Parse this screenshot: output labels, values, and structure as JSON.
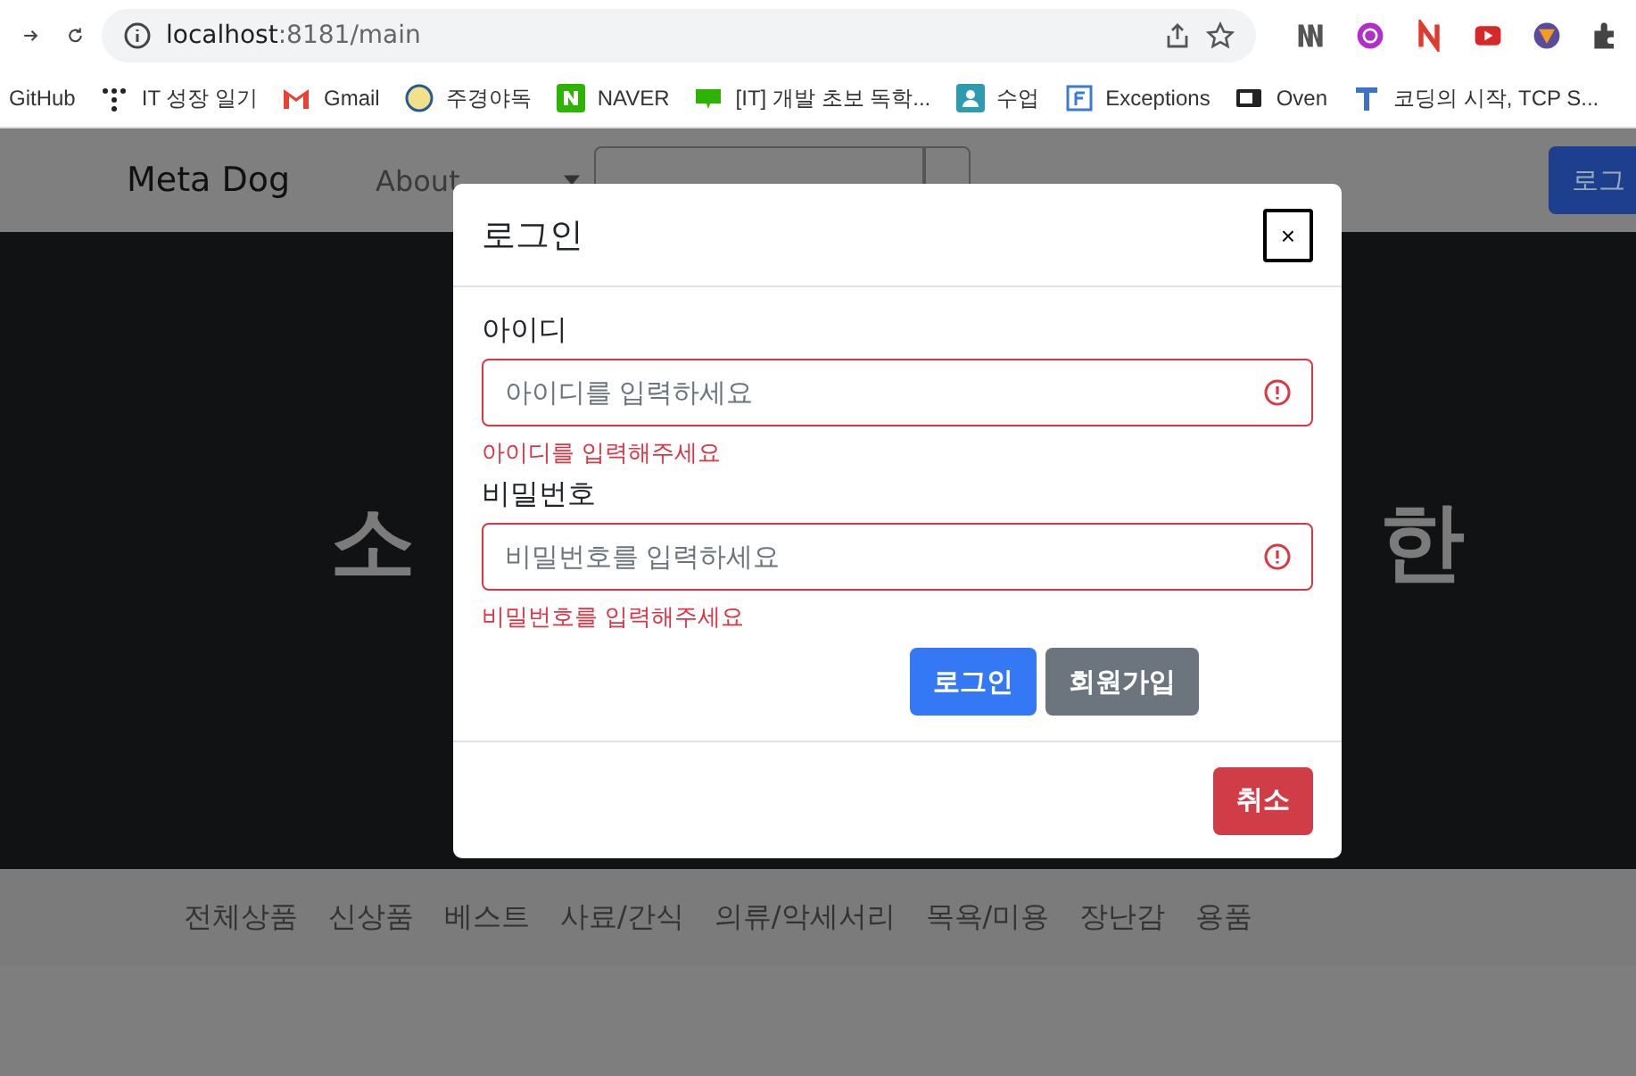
{
  "browser": {
    "url_host": "localhost",
    "url_rest": ":8181/main"
  },
  "bookmarks": [
    {
      "label": "GitHub",
      "kind": "none"
    },
    {
      "label": "IT 성장 일기",
      "kind": "dots"
    },
    {
      "label": "Gmail",
      "kind": "mail"
    },
    {
      "label": "주경야독",
      "kind": "round"
    },
    {
      "label": "NAVER",
      "kind": "naver"
    },
    {
      "label": "[IT] 개발 초보 독학...",
      "kind": "blog"
    },
    {
      "label": "수업",
      "kind": "person"
    },
    {
      "label": "Exceptions",
      "kind": "doc"
    },
    {
      "label": "Oven",
      "kind": "oven"
    },
    {
      "label": "코딩의 시작, TCP S...",
      "kind": "t"
    }
  ],
  "navbar": {
    "brand": "Meta Dog",
    "links": [
      "About"
    ],
    "login": "로그"
  },
  "hero": {
    "left": "소",
    "right": "한"
  },
  "categories": [
    "전체상품",
    "신상품",
    "베스트",
    "사료/간식",
    "의류/악세서리",
    "목욕/미용",
    "장난감",
    "용품"
  ],
  "modal": {
    "title": "로그인",
    "close": "×",
    "fields": [
      {
        "label": "아이디",
        "placeholder": "아이디를 입력하세요",
        "invalid": true,
        "error": "아이디를 입력해주세요"
      },
      {
        "label": "비밀번호",
        "placeholder": "비밀번호를 입력하세요",
        "invalid": true,
        "error": "비밀번호를 입력해주세요"
      }
    ],
    "buttons": [
      {
        "label": "로그인",
        "kind": "primary"
      },
      {
        "label": "회원가입",
        "kind": "secondary"
      }
    ],
    "footer_button": "취소"
  }
}
